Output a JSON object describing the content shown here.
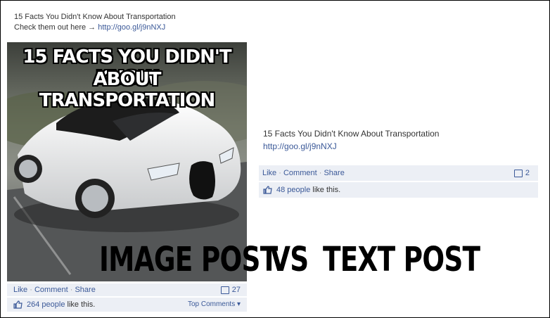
{
  "image_post": {
    "caption_line1": "15 Facts You Didn't Know About Transportation",
    "caption_prefix": "Check them out here → ",
    "caption_link": "http://goo.gl/j9nNXJ",
    "image_title_line1": "15 FACTS YOU DIDN'T KNOW",
    "image_title_line2": "ABOUT TRANSPORTATION",
    "actions": {
      "like": "Like",
      "comment": "Comment",
      "share": "Share",
      "sep": "·"
    },
    "comment_count": "27",
    "likes_link": "264 people",
    "likes_suffix": " like this.",
    "top_comments": "Top Comments ▾"
  },
  "text_post": {
    "title": "15 Facts You Didn't Know About Transportation",
    "link": "http://goo.gl/j9nNXJ",
    "actions": {
      "like": "Like",
      "comment": "Comment",
      "share": "Share",
      "sep": "·"
    },
    "comment_count": "2",
    "likes_link": "48 people",
    "likes_suffix": " like this."
  },
  "labels": {
    "image_post": "IMAGE POST",
    "vs": "VS",
    "text_post": "TEXT POST"
  },
  "colors": {
    "link": "#3b5998",
    "bar_bg": "#eceff5"
  },
  "icons": [
    "comment-icon",
    "like-thumb-icon",
    "car-photo"
  ]
}
